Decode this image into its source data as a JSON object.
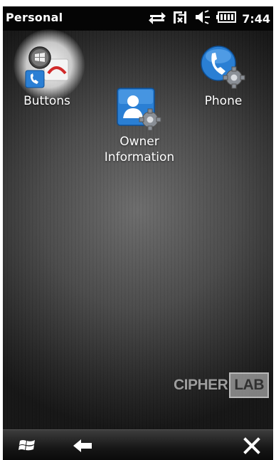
{
  "status_bar": {
    "title": "Personal",
    "time": "7:44",
    "icons": [
      "data-sync-icon",
      "signal-icon",
      "volume-icon",
      "battery-icon"
    ]
  },
  "desktop": {
    "apps": [
      {
        "label": "Buttons",
        "icon": "buttons-app-icon",
        "selected": true
      },
      {
        "label": "Owner\nInformation",
        "icon": "owner-information-app-icon",
        "selected": false
      },
      {
        "label": "Phone",
        "icon": "phone-settings-app-icon",
        "selected": false
      }
    ],
    "watermark": {
      "left": "CIPHER",
      "right": "LAB"
    }
  },
  "taskbar": {
    "buttons": [
      "start-icon",
      "back-arrow-icon",
      "close-icon"
    ]
  },
  "colors": {
    "icon_blue": "#2a7fd4",
    "background_dark": "#2b2b2b",
    "accent_red": "#d12a2a"
  }
}
